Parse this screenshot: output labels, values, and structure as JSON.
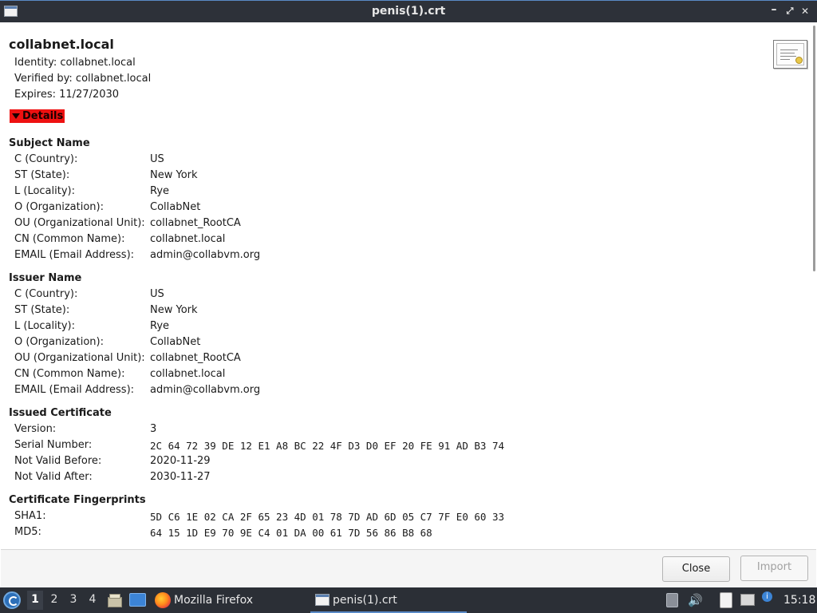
{
  "window": {
    "title": "penis(1).crt",
    "controls": [
      "minimize",
      "maximize",
      "close"
    ]
  },
  "certificate": {
    "name": "collabnet.local",
    "identity": "Identity: collabnet.local",
    "verified_by": "Verified by: collabnet.local",
    "expires": "Expires: 11/27/2030",
    "details_label": "Details"
  },
  "subject": {
    "title": "Subject Name",
    "fields": [
      {
        "label": "C (Country):",
        "value": "US"
      },
      {
        "label": "ST (State):",
        "value": "New York"
      },
      {
        "label": "L (Locality):",
        "value": "Rye"
      },
      {
        "label": "O (Organization):",
        "value": "CollabNet"
      },
      {
        "label": "OU (Organizational Unit):",
        "value": "collabnet_RootCA"
      },
      {
        "label": "CN (Common Name):",
        "value": "collabnet.local"
      },
      {
        "label": "EMAIL (Email Address):",
        "value": "admin@collabvm.org"
      }
    ]
  },
  "issuer": {
    "title": "Issuer Name",
    "fields": [
      {
        "label": "C (Country):",
        "value": "US"
      },
      {
        "label": "ST (State):",
        "value": "New York"
      },
      {
        "label": "L (Locality):",
        "value": "Rye"
      },
      {
        "label": "O (Organization):",
        "value": "CollabNet"
      },
      {
        "label": "OU (Organizational Unit):",
        "value": "collabnet_RootCA"
      },
      {
        "label": "CN (Common Name):",
        "value": "collabnet.local"
      },
      {
        "label": "EMAIL (Email Address):",
        "value": "admin@collabvm.org"
      }
    ]
  },
  "issued": {
    "title": "Issued Certificate",
    "fields": [
      {
        "label": "Version:",
        "value": "3"
      },
      {
        "label": "Serial Number:",
        "value": "2C 64 72 39 DE 12 E1 A8 BC 22 4F D3 D0 EF 20 FE 91 AD B3 74"
      },
      {
        "label": "Not Valid Before:",
        "value": "2020-11-29"
      },
      {
        "label": "Not Valid After:",
        "value": "2030-11-27"
      }
    ]
  },
  "fingerprints": {
    "title": "Certificate Fingerprints",
    "fields": [
      {
        "label": "SHA1:",
        "value": "5D C6 1E 02 CA 2F 65 23 4D 01 78 7D AD 6D 05 C7 7F E0 60 33"
      },
      {
        "label": "MD5:",
        "value": "64 15 1D E9 70 9E C4 01 DA 00 61 7D 56 86 B8 68"
      }
    ]
  },
  "buttons": {
    "close": "Close",
    "import": "Import"
  },
  "taskbar": {
    "workspaces": [
      "1",
      "2",
      "3",
      "4"
    ],
    "active_workspace": "1",
    "tasks": [
      {
        "label": "Mozilla Firefox",
        "icon": "firefox-icon"
      },
      {
        "label": "penis(1).crt",
        "icon": "certificate-window-icon",
        "active": true
      }
    ],
    "clock": "15:18"
  },
  "colors": {
    "details_highlight": "#ee1111",
    "titlebar": "#2d3139",
    "taskbar": "#2b2f36",
    "accent": "#5a8ac6"
  }
}
